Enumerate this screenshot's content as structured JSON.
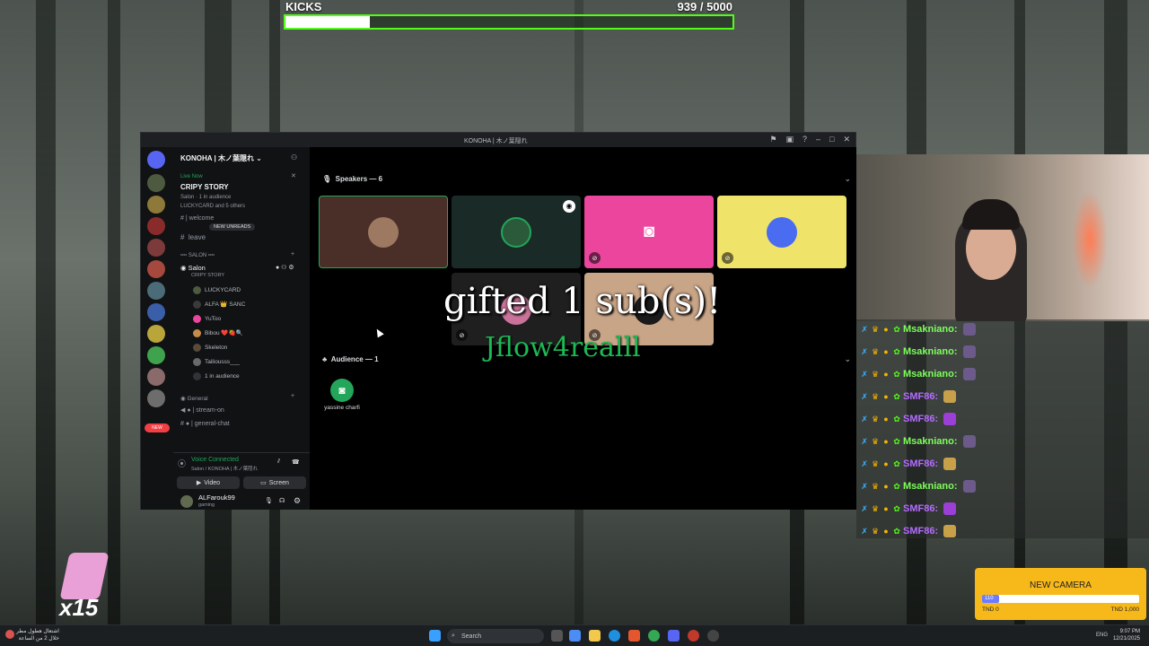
{
  "overlay": {
    "kicks_label": "KICKS",
    "kicks_current": "939",
    "kicks_goal": "/ 5000",
    "kicks_progress": 0.188
  },
  "discord": {
    "window_title": "KONOHA | 木ノ葉隠れ",
    "server_name": "KONOHA | 木ノ葉隠れ ⌄",
    "live_now": "Live Now",
    "live_title": "CRIPY STORY",
    "live_meta": "Salon · 1 in audience",
    "live_users": "LUCKYCARD and 5 others",
    "new_unreads": "NEW UNREADS",
    "ch_welcome": "| welcome",
    "ch_leave": "leave",
    "category_salon": "SALON",
    "salon_channel": "Salon",
    "salon_sub": "CRIPY STORY",
    "voice_users": [
      "LUCKYCARD",
      "ALFA 👑 SANC",
      "YuToo",
      "Bibou ❤️🍓🔍",
      "Skeleton",
      "Tailiousss___",
      "1 in audience"
    ],
    "category_general": "General",
    "ch_stream": "| stream-on",
    "ch_general_chat": "| general-chat",
    "voice_connected": "Voice Connected",
    "voice_channel": "Salon / KONOHA | 木ノ葉隠れ",
    "video_label": "Video",
    "screen_label": "Screen",
    "username": "ALFarouk99",
    "user_status": "gaming",
    "new_badge": "NEW",
    "speakers_header": "Speakers — 6",
    "audience_header": "Audience — 1",
    "audience_user": "yassine charfi"
  },
  "gift_alert": {
    "line1": "gifted 1 sub(s)!",
    "line2": "Jflow4realll"
  },
  "chat": {
    "messages": [
      {
        "user": "Msakniano:",
        "color": "#7dff5a",
        "emote_color": "#6b5a8a"
      },
      {
        "user": "Msakniano:",
        "color": "#7dff5a",
        "emote_color": "#6b5a8a"
      },
      {
        "user": "Msakniano:",
        "color": "#7dff5a",
        "emote_color": "#6b5a8a"
      },
      {
        "user": "SMF86:",
        "color": "#b46cff",
        "emote_color": "#c9a04a"
      },
      {
        "user": "SMF86:",
        "color": "#b46cff",
        "emote_color": "#9b3fd6"
      },
      {
        "user": "Msakniano:",
        "color": "#7dff5a",
        "emote_color": "#6b5a8a"
      },
      {
        "user": "SMF86:",
        "color": "#b46cff",
        "emote_color": "#c9a04a"
      },
      {
        "user": "Msakniano:",
        "color": "#7dff5a",
        "emote_color": "#6b5a8a"
      },
      {
        "user": "SMF86:",
        "color": "#b46cff",
        "emote_color": "#9b3fd6"
      },
      {
        "user": "SMF86:",
        "color": "#b46cff",
        "emote_color": "#c9a04a"
      }
    ]
  },
  "gift_counter": "x15",
  "goal": {
    "title": "NEW CAMERA",
    "current": "110",
    "progress": 0.11,
    "min": "TND 0",
    "max": "TND 1,000"
  },
  "taskbar": {
    "news_line1": "اشتعال هطول مطر",
    "news_line2": "خلال 2 من الساعة",
    "search": "Search",
    "lang": "ENG",
    "time": "9:07 PM",
    "date": "12/21/2025"
  },
  "colors": {
    "kick_green": "#53fc18",
    "discord_blurple": "#5865f2",
    "discord_green": "#23a55a",
    "goal_yellow": "#f7b81a"
  }
}
